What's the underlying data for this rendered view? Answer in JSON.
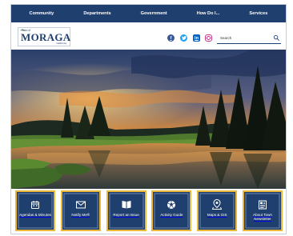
{
  "nav": {
    "items": [
      {
        "label": "Community"
      },
      {
        "label": "Departments"
      },
      {
        "label": "Government"
      },
      {
        "label": "How Do I..."
      },
      {
        "label": "Services"
      }
    ]
  },
  "logo": {
    "prefix": "Town of",
    "name": "MORAGA",
    "suffix": "California"
  },
  "social": {
    "facebook": "f",
    "twitter": "t",
    "linkedin": "in",
    "instagram": ""
  },
  "search": {
    "placeholder": "Search",
    "icon": "search-icon"
  },
  "hero": {
    "description_icon": "landscape-photo"
  },
  "quick_links": [
    {
      "label": "Agendas & Minutes",
      "icon": "calendar-icon"
    },
    {
      "label": "Notify Me®",
      "icon": "envelope-icon"
    },
    {
      "label": "Report an Issue",
      "icon": "book-icon"
    },
    {
      "label": "Activity Guide",
      "icon": "soccer-ball-icon"
    },
    {
      "label": "Maps & GIS",
      "icon": "map-pin-icon"
    },
    {
      "label": "About Town Newsletter",
      "icon": "newsletter-icon"
    }
  ],
  "colors": {
    "nav_bg": "#1f3f6e",
    "tile_border": "#eab739",
    "tile_bg": "#1f3f6e"
  }
}
